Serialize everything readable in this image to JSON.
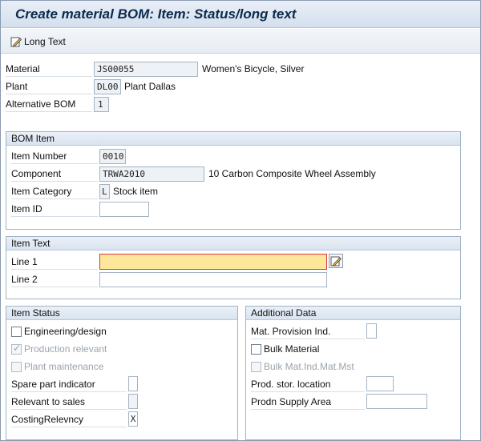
{
  "window": {
    "title": "Create material BOM: Item: Status/long text"
  },
  "toolbar": {
    "long_text_label": "Long Text",
    "long_text_icon": "edit-pencil-icon"
  },
  "header": {
    "material_label": "Material",
    "material_value": "JS00055",
    "material_desc": "Women's Bicycle, Silver",
    "plant_label": "Plant",
    "plant_value": "DL00",
    "plant_desc": "Plant Dallas",
    "altbom_label": "Alternative BOM",
    "altbom_value": "1"
  },
  "bom_item": {
    "title": "BOM Item",
    "item_number_label": "Item Number",
    "item_number_value": "0010",
    "component_label": "Component",
    "component_value": "TRWA2010",
    "component_desc": "10 Carbon Composite Wheel Assembly",
    "item_category_label": "Item Category",
    "item_category_value": "L",
    "item_category_desc": "Stock item",
    "item_id_label": "Item ID",
    "item_id_value": ""
  },
  "item_text": {
    "title": "Item Text",
    "line1_label": "Line 1",
    "line1_value": "",
    "line2_label": "Line 2",
    "line2_value": ""
  },
  "item_status": {
    "title": "Item Status",
    "engineering_label": "Engineering/design",
    "engineering_checked": false,
    "production_label": "Production relevant",
    "production_checked": true,
    "plant_maint_label": "Plant maintenance",
    "plant_maint_checked": false,
    "spare_part_label": "Spare part indicator",
    "spare_part_value": "",
    "relevant_sales_label": "Relevant to sales",
    "relevant_sales_value": "",
    "costing_label": "CostingRelevncy",
    "costing_value": "X"
  },
  "additional_data": {
    "title": "Additional Data",
    "mat_prov_label": "Mat. Provision Ind.",
    "mat_prov_value": "",
    "bulk_material_label": "Bulk Material",
    "bulk_material_checked": false,
    "bulk_mat_mst_label": "Bulk Mat.Ind.Mat.Mst",
    "bulk_mat_mst_checked": false,
    "prod_stor_label": "Prod. stor. location",
    "prod_stor_value": "",
    "supply_area_label": "Prodn Supply Area",
    "supply_area_value": ""
  },
  "colors": {
    "active_field": "#fde79a",
    "active_border": "#d9343a",
    "title_text": "#0c2a4d"
  }
}
